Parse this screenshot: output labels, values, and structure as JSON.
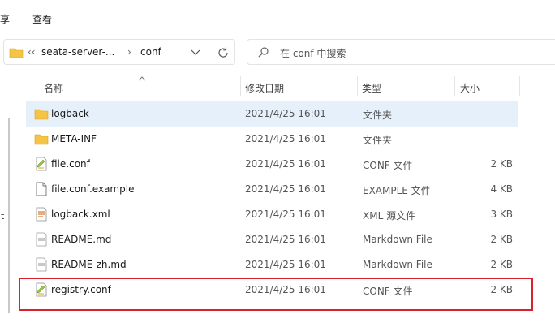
{
  "ribbon": {
    "tab_share": "享",
    "tab_view": "查看"
  },
  "address": {
    "overflow": "‹‹",
    "crumb1": "seata-server-...",
    "sep": "›",
    "crumb2": "conf"
  },
  "search": {
    "placeholder": "在 conf 中搜索"
  },
  "columns": {
    "name": "名称",
    "modified": "修改日期",
    "type": "类型",
    "size": "大小"
  },
  "files": [
    {
      "name": "logback",
      "modified": "2021/4/25 16:01",
      "type": "文件夹",
      "size": "",
      "icon": "folder-icon"
    },
    {
      "name": "META-INF",
      "modified": "2021/4/25 16:01",
      "type": "文件夹",
      "size": "",
      "icon": "folder-icon"
    },
    {
      "name": "file.conf",
      "modified": "2021/4/25 16:01",
      "type": "CONF 文件",
      "size": "2 KB",
      "icon": "conf-file-icon"
    },
    {
      "name": "file.conf.example",
      "modified": "2021/4/25 16:01",
      "type": "EXAMPLE 文件",
      "size": "4 KB",
      "icon": "blank-file-icon"
    },
    {
      "name": "logback.xml",
      "modified": "2021/4/25 16:01",
      "type": "XML 源文件",
      "size": "3 KB",
      "icon": "xml-file-icon"
    },
    {
      "name": "README.md",
      "modified": "2021/4/25 16:01",
      "type": "Markdown File",
      "size": "2 KB",
      "icon": "markdown-file-icon"
    },
    {
      "name": "README-zh.md",
      "modified": "2021/4/25 16:01",
      "type": "Markdown File",
      "size": "2 KB",
      "icon": "markdown-file-icon"
    },
    {
      "name": "registry.conf",
      "modified": "2021/4/25 16:01",
      "type": "CONF 文件",
      "size": "2 KB",
      "icon": "conf-file-icon"
    }
  ],
  "colors": {
    "highlight": "#d9202c",
    "selection": "#e5f0fb",
    "folder": "#f5c445"
  }
}
